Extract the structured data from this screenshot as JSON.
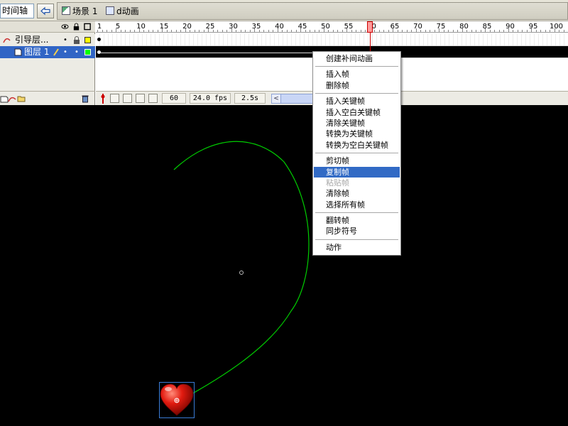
{
  "topbar": {
    "timeline_label": "时间轴",
    "scene_label": "场景 1",
    "symbol_label": "d动画"
  },
  "layers": [
    {
      "name": "引导层...",
      "icon": "guide-layer-icon",
      "selected": false,
      "color": "#ffff00"
    },
    {
      "name": "图层 1",
      "icon": "layer-icon",
      "selected": true,
      "color": "#00ff00"
    }
  ],
  "ruler": {
    "labels": [
      "1",
      "5",
      "10",
      "15",
      "20",
      "25",
      "30",
      "35",
      "40",
      "45",
      "50",
      "55",
      "60",
      "65",
      "70",
      "75",
      "80",
      "85",
      "90",
      "95",
      "100"
    ],
    "current_frame": 60
  },
  "status": {
    "frame": "60",
    "fps": "24.0 fps",
    "time": "2.5s"
  },
  "context_menu": {
    "items": [
      {
        "label": "创建补间动画",
        "state": "normal"
      },
      {
        "label": "-"
      },
      {
        "label": "插入帧",
        "state": "normal"
      },
      {
        "label": "删除帧",
        "state": "normal"
      },
      {
        "label": "-"
      },
      {
        "label": "插入关键帧",
        "state": "normal"
      },
      {
        "label": "插入空白关键帧",
        "state": "normal"
      },
      {
        "label": "清除关键帧",
        "state": "normal"
      },
      {
        "label": "转换为关键帧",
        "state": "normal"
      },
      {
        "label": "转换为空白关键帧",
        "state": "normal"
      },
      {
        "label": "-"
      },
      {
        "label": "剪切帧",
        "state": "normal"
      },
      {
        "label": "复制帧",
        "state": "highlighted"
      },
      {
        "label": "粘贴帧",
        "state": "disabled"
      },
      {
        "label": "清除帧",
        "state": "normal"
      },
      {
        "label": "选择所有帧",
        "state": "normal"
      },
      {
        "label": "-"
      },
      {
        "label": "翻转帧",
        "state": "normal"
      },
      {
        "label": "同步符号",
        "state": "normal"
      },
      {
        "label": "-"
      },
      {
        "label": "动作",
        "state": "normal"
      }
    ]
  },
  "stage": {
    "background": "#000000",
    "guide_path_color": "#00cc00",
    "selection_color": "#3a7bd5"
  }
}
